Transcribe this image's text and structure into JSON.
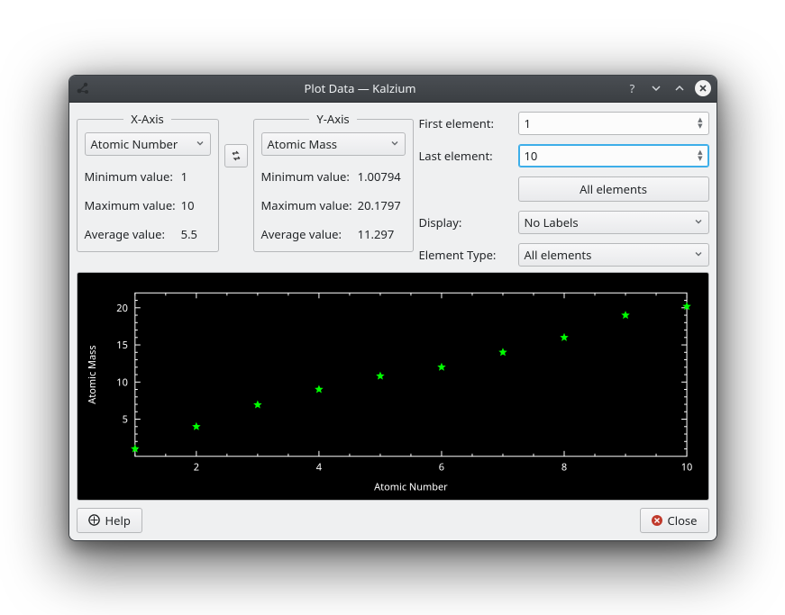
{
  "window": {
    "title": "Plot Data — Kalzium"
  },
  "xaxis": {
    "title": "X-Axis",
    "combo": "Atomic Number",
    "min_label": "Minimum value:",
    "min_value": "1",
    "max_label": "Maximum value:",
    "max_value": "10",
    "avg_label": "Average value:",
    "avg_value": "5.5"
  },
  "yaxis": {
    "title": "Y-Axis",
    "combo": "Atomic Mass",
    "min_label": "Minimum value:",
    "min_value": "1.00794",
    "max_label": "Maximum value:",
    "max_value": "20.1797",
    "avg_label": "Average value:",
    "avg_value": "11.297"
  },
  "form": {
    "first_label": "First element:",
    "first_value": "1",
    "last_label": "Last element:",
    "last_value": "10",
    "all_elements_btn": "All elements",
    "display_label": "Display:",
    "display_value": "No Labels",
    "type_label": "Element Type:",
    "type_value": "All elements"
  },
  "footer": {
    "help": "Help",
    "close": "Close"
  },
  "chart_data": {
    "type": "scatter",
    "title": "",
    "xlabel": "Atomic Number",
    "ylabel": "Atomic Mass",
    "xlim": [
      1,
      10
    ],
    "ylim": [
      0,
      22
    ],
    "x": [
      1,
      2,
      3,
      4,
      5,
      6,
      7,
      8,
      9,
      10
    ],
    "y": [
      1.00794,
      4.0026,
      6.941,
      9.0122,
      10.811,
      12.011,
      14.007,
      15.999,
      18.998,
      20.1797
    ],
    "x_ticks": [
      2,
      4,
      6,
      8,
      10
    ],
    "y_ticks": [
      5,
      10,
      15,
      20
    ]
  }
}
